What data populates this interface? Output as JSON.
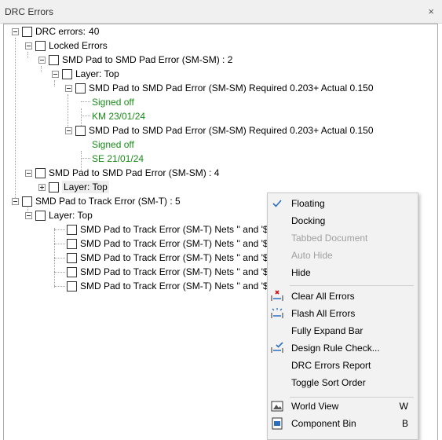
{
  "window": {
    "title": "DRC Errors",
    "close_glyph": "×"
  },
  "tree": {
    "root": {
      "label": "DRC errors:",
      "count": "40"
    },
    "locked": {
      "label": "Locked Errors"
    },
    "locked_group": {
      "label": "SMD Pad to SMD Pad Error (SM-SM) : 2"
    },
    "locked_layer": {
      "label": "Layer: Top"
    },
    "locked_err1": {
      "label": "SMD Pad to SMD Pad Error (SM-SM) Required 0.203+ Actual 0.150",
      "status": "Signed off",
      "signer": "KM 23/01/24"
    },
    "locked_err2": {
      "label": "SMD Pad to SMD Pad Error (SM-SM) Required 0.203+ Actual 0.150",
      "status": "Signed off",
      "signer": "SE 21/01/24"
    },
    "smsm_group": {
      "label": "SMD Pad to SMD Pad Error (SM-SM) : 4"
    },
    "smsm_layer": {
      "label": "Layer: Top"
    },
    "smt_group": {
      "label": "SMD Pad to Track Error (SM-T) : 5"
    },
    "smt_layer": {
      "label": "Layer: Top"
    },
    "smt_items": [
      "SMD Pad to Track Error (SM-T) Nets '' and '$8",
      "SMD Pad to Track Error (SM-T) Nets '' and '$9",
      "SMD Pad to Track Error (SM-T) Nets '' and '$9",
      "SMD Pad to Track Error (SM-T) Nets '' and '$9",
      "SMD Pad to Track Error (SM-T) Nets '' and '$9"
    ]
  },
  "menu": {
    "floating": "Floating",
    "docking": "Docking",
    "tabbed": "Tabbed Document",
    "autohide": "Auto Hide",
    "hide": "Hide",
    "clear_all": "Clear All Errors",
    "flash_all": "Flash All Errors",
    "expand_bar": "Fully Expand Bar",
    "drc": "Design Rule Check...",
    "report": "DRC Errors Report",
    "toggle_sort": "Toggle Sort Order",
    "world_view": "World View",
    "world_view_key": "W",
    "component_bin": "Component Bin",
    "component_bin_key": "B"
  },
  "colors": {
    "signed_off": "#1a8a1a",
    "accent": "#2a6fbf",
    "error_red": "#d01010"
  }
}
